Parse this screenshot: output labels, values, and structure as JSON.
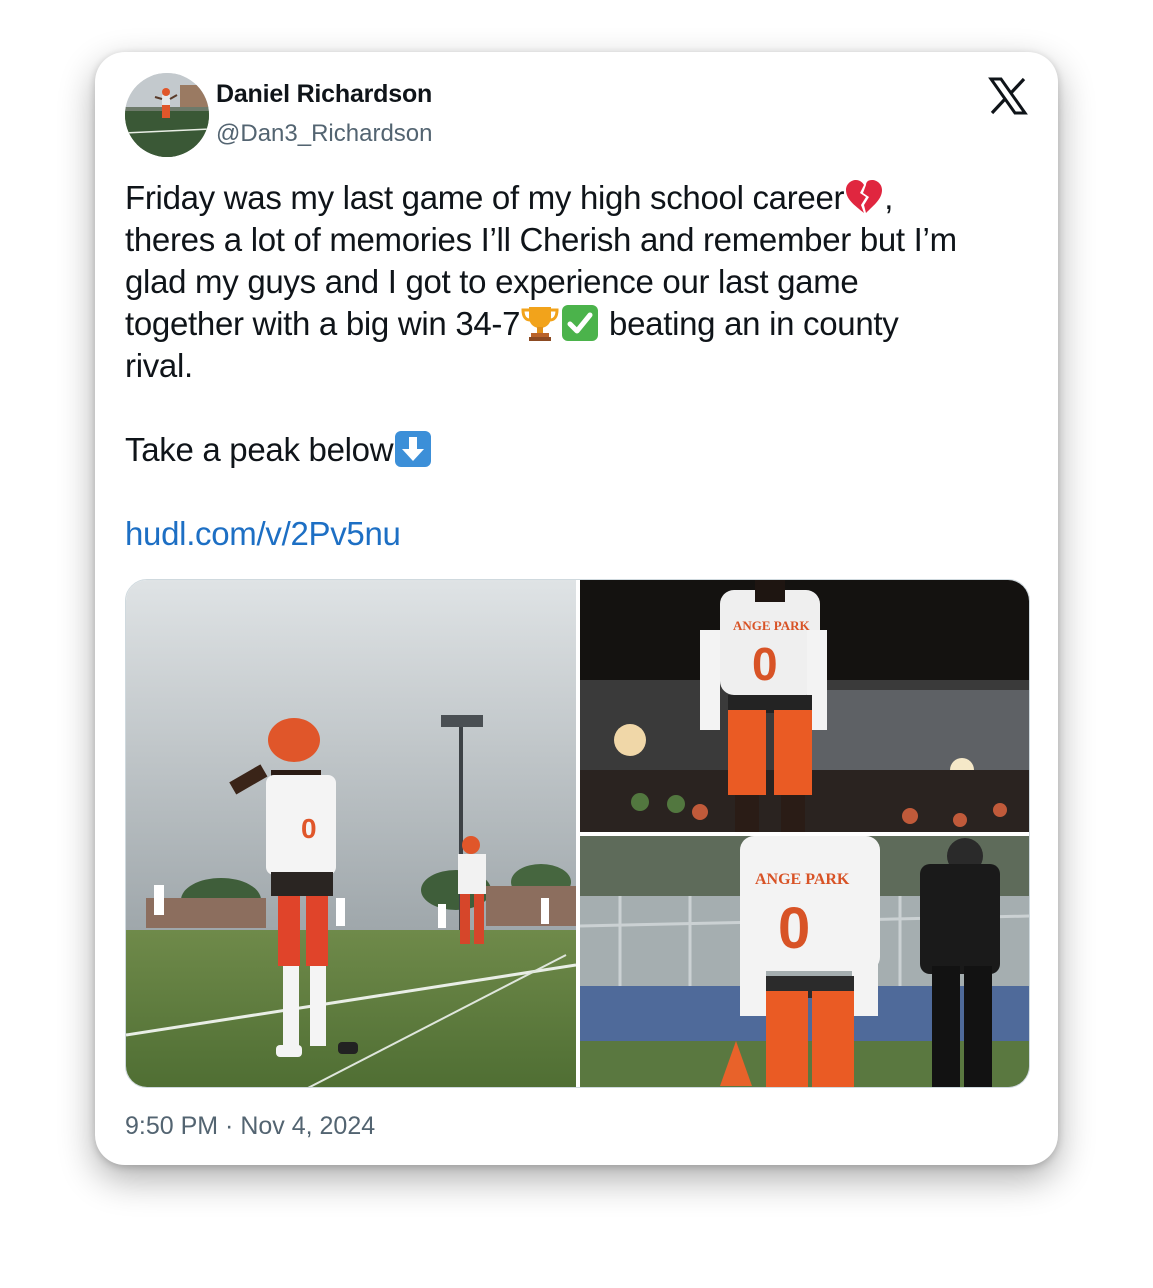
{
  "author": {
    "name": "Daniel Richardson",
    "handle": "@Dan3_Richardson"
  },
  "brand": {
    "logo_icon": "x-logo-icon",
    "text_color": "#0f1419",
    "secondary_color": "#536471",
    "link_color": "#1d6fc4"
  },
  "tweet": {
    "line1": "Friday was my last game of my high school career",
    "line1_after_emoji": ",",
    "line2": "theres a lot of memories I’ll Cherish and remember but I’m",
    "line3": "glad my guys and I got to experience our last game",
    "line4_pre": "together with a big win 34-7",
    "line4_post": " beating an in county",
    "line5": "rival.",
    "para2": "Take a peak below",
    "link": "hudl.com/v/2Pv5nu",
    "emojis": [
      "broken-heart-icon",
      "trophy-icon",
      "check-mark-icon",
      "down-arrow-icon"
    ]
  },
  "media": {
    "photos": [
      "photo-quarterback-on-field",
      "photo-player-night-game",
      "photo-player-sideline"
    ],
    "jersey_text": "ANGE PARK",
    "jersey_number": "0"
  },
  "timestamp": "9:50 PM · Nov 4, 2024"
}
